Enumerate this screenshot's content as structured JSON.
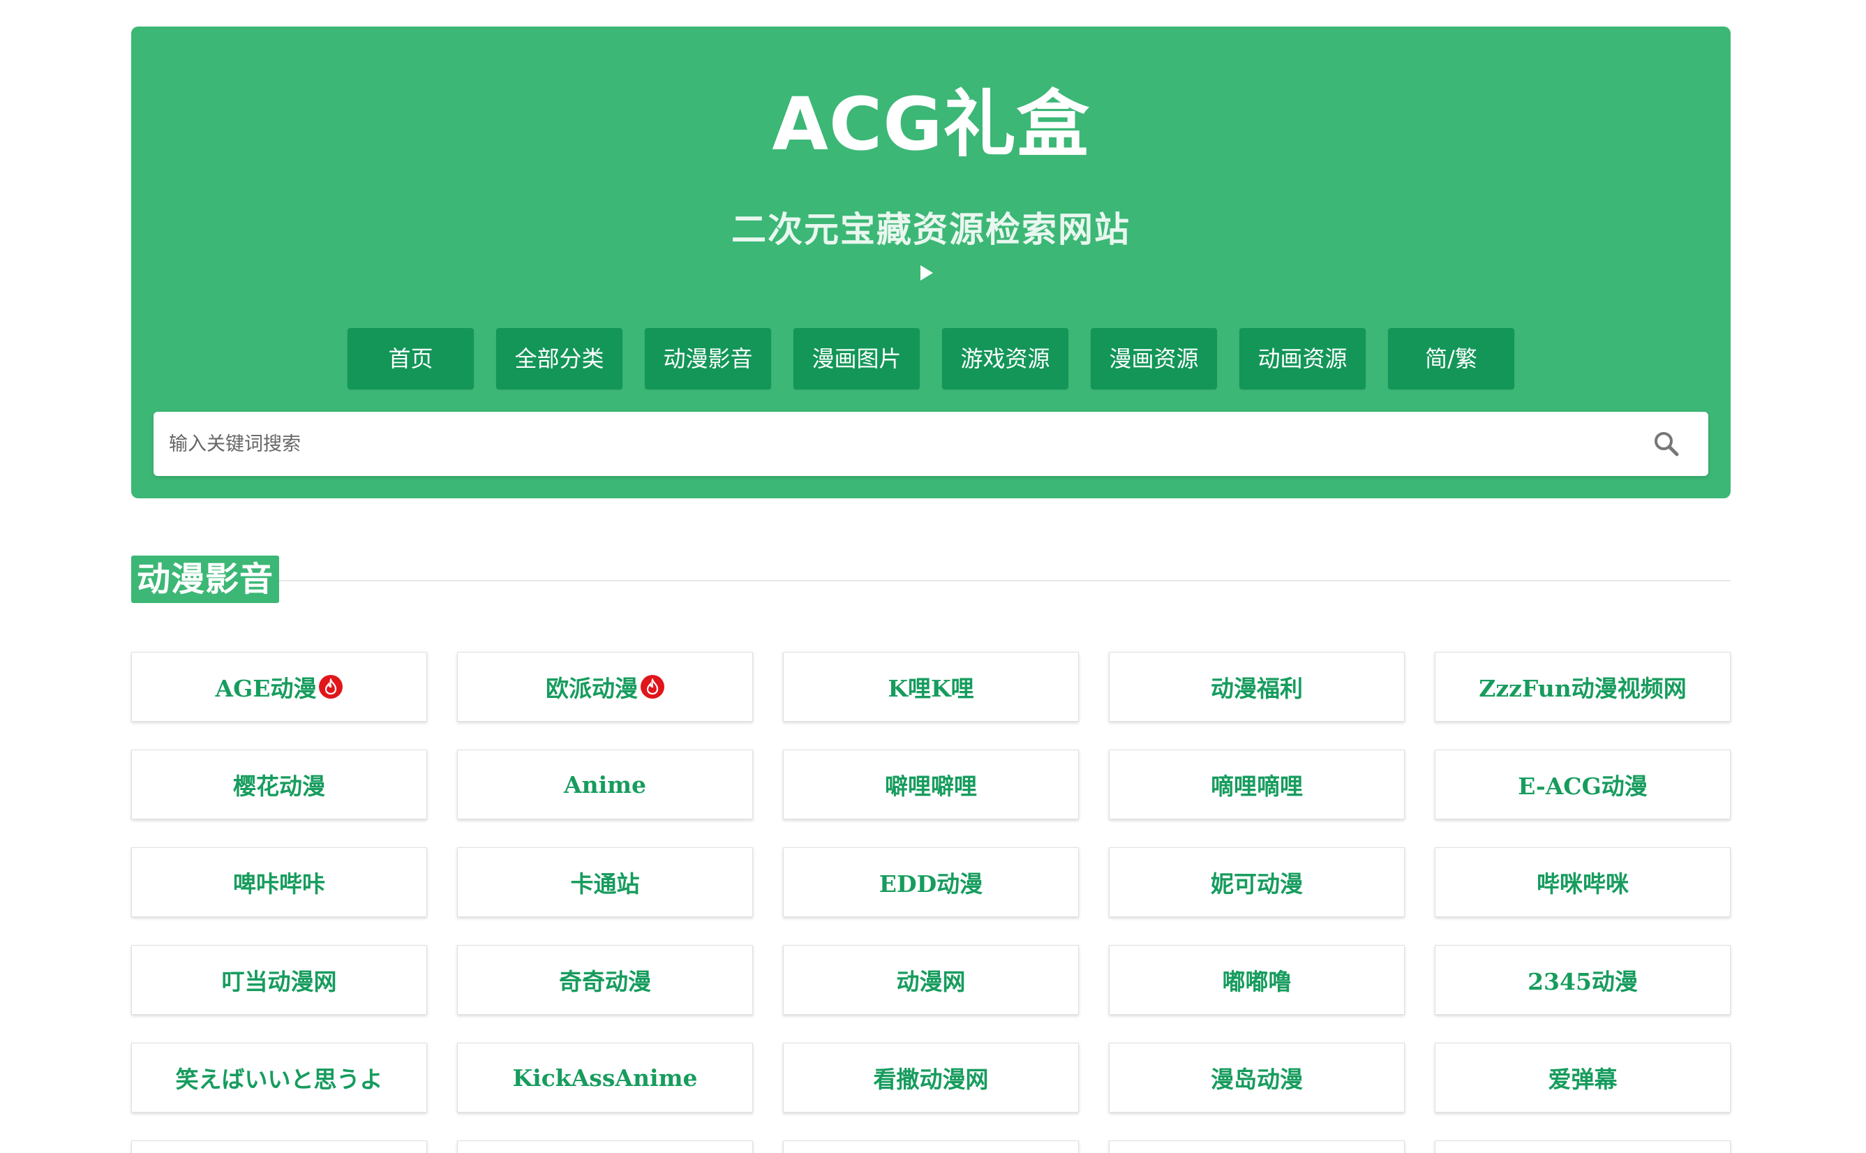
{
  "header": {
    "title": "ACG礼盒",
    "subtitle": "二次元宝藏资源检索网站"
  },
  "nav": [
    {
      "label": "首页"
    },
    {
      "label": "全部分类"
    },
    {
      "label": "动漫影音"
    },
    {
      "label": "漫画图片"
    },
    {
      "label": "游戏资源"
    },
    {
      "label": "漫画资源"
    },
    {
      "label": "动画资源"
    },
    {
      "label": "简/繁"
    }
  ],
  "search": {
    "placeholder": "输入关键词搜索",
    "value": ""
  },
  "section": {
    "title": "动漫影音",
    "items": [
      {
        "label": "AGE动漫",
        "icon": "hot-icon"
      },
      {
        "label": "欧派动漫",
        "icon": "hot-icon"
      },
      {
        "label": "K哩K哩"
      },
      {
        "label": "动漫福利"
      },
      {
        "label": "ZzzFun动漫视频网"
      },
      {
        "label": "樱花动漫"
      },
      {
        "label": "Anime"
      },
      {
        "label": "噼哩噼哩"
      },
      {
        "label": "嘀哩嘀哩"
      },
      {
        "label": "E-ACG动漫"
      },
      {
        "label": "啤咔哔咔"
      },
      {
        "label": "卡通站"
      },
      {
        "label": "EDD动漫"
      },
      {
        "label": "妮可动漫"
      },
      {
        "label": "哔咪哔咪"
      },
      {
        "label": "叮当动漫网"
      },
      {
        "label": "奇奇动漫"
      },
      {
        "label": "动漫网"
      },
      {
        "label": "嘟嘟噜"
      },
      {
        "label": "2345动漫"
      },
      {
        "label": "笑えばいいと思うよ"
      },
      {
        "label": "KickAssAnime"
      },
      {
        "label": "看撒动漫网"
      },
      {
        "label": "漫岛动漫"
      },
      {
        "label": "爱弹幕"
      },
      {
        "label": ""
      },
      {
        "label": ""
      },
      {
        "label": ""
      },
      {
        "label": ""
      },
      {
        "label": ""
      }
    ]
  },
  "colors": {
    "brand_green": "#3cb776",
    "nav_button": "#139658",
    "link_text": "#179c5e",
    "hot_badge": "#e0161b"
  }
}
